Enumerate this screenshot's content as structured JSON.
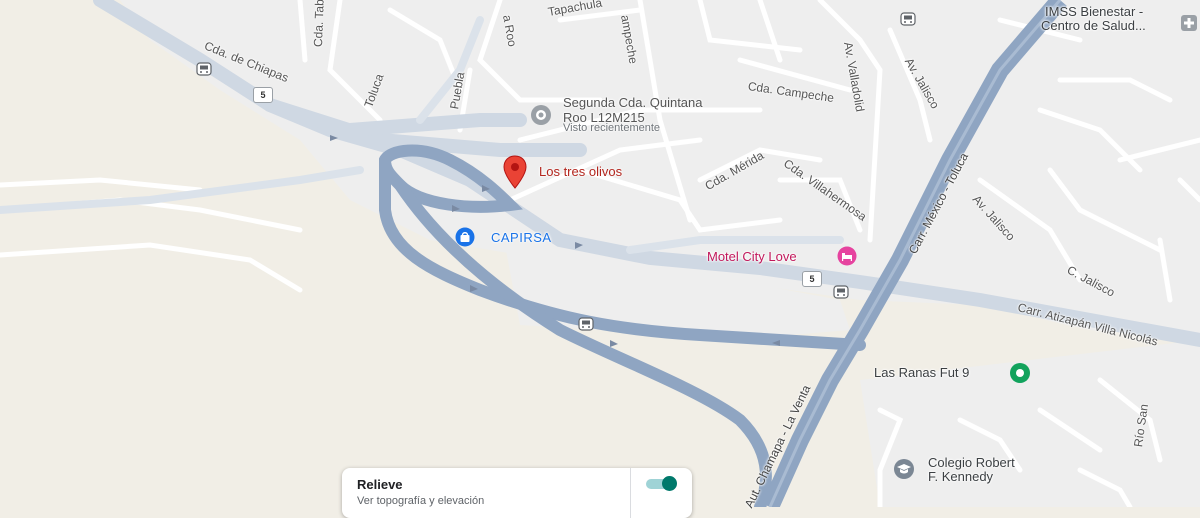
{
  "map": {
    "colors": {
      "background": "#f1eee6",
      "urban": "#eeeeee",
      "street": "#ffffff",
      "main_road": "#cfd8e3",
      "highway": "#8fa5c2"
    },
    "places": [
      {
        "key": "segunda",
        "line1": "Segunda Cda. Quintana",
        "line2": "Roo L12M215",
        "sub": "Visto recientemente",
        "icon": "history-pin-icon"
      },
      {
        "key": "tres_olivos",
        "name": "Los tres olivos",
        "icon": "red-map-pin-icon"
      },
      {
        "key": "capirsa",
        "name": "CAPIRSA",
        "icon": "shopping-bag-icon"
      },
      {
        "key": "motel",
        "name": "Motel City Love",
        "icon": "hotel-bed-icon"
      },
      {
        "key": "ranas",
        "name": "Las Ranas Fut 9",
        "icon": "sports-pin-icon"
      },
      {
        "key": "colegio",
        "line1": "Colegio Robert",
        "line2": "F. Kennedy",
        "icon": "school-icon"
      },
      {
        "key": "imss",
        "line1": "IMSS Bienestar -",
        "line2": "Centro de Salud...",
        "icon": "hospital-icon"
      }
    ],
    "streets": {
      "cda_chiapas": "Cda. de Chiapas",
      "cda_tab": "Cda. Tab",
      "tapachula": "Tapachula",
      "roo": "a Roo",
      "campeche": "ampeche",
      "av_valladolid": "Av. Valladolid",
      "av_jalisco_top": "Av. Jalisco",
      "cda_campeche": "Cda. Campeche",
      "toluca": "Toluca",
      "puebla": "Puebla",
      "cda_merida": "Cda. Mérida",
      "cda_villahermosa": "Cda. Villahermosa",
      "carr_mexico_toluca": "Carr. México - Toluca",
      "av_jalisco_right": "Av. Jalisco",
      "c_jalisco": "C. Jalisco",
      "carr_atizapan": "Carr. Atizapán Villa Nicolás",
      "rio_san": "Río San",
      "autopista": "Aut. Chamapa - La Venta"
    },
    "route_shields": [
      "5",
      "5"
    ]
  },
  "relief_card": {
    "title": "Relieve",
    "description": "Ver topografía y elevación",
    "toggle_on": true
  }
}
